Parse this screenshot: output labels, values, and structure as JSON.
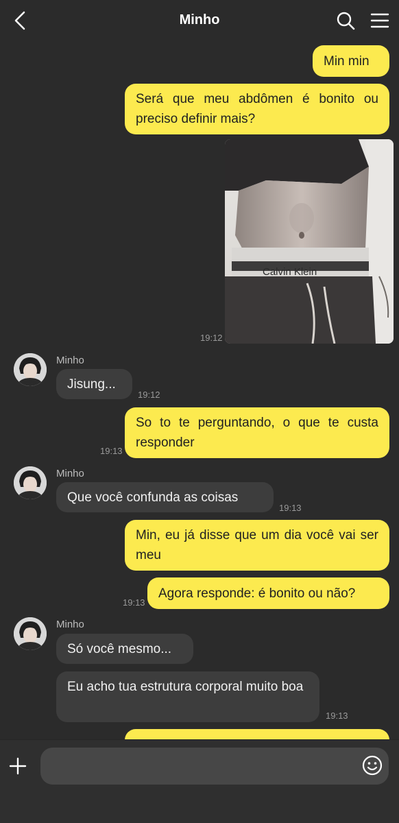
{
  "header": {
    "title": "Minho",
    "back_icon": "chevron-left-icon",
    "search_icon": "search-icon",
    "menu_icon": "hamburger-menu-icon"
  },
  "messages": [
    {
      "from": "me",
      "text": "Min min"
    },
    {
      "from": "me",
      "text": "Será que meu abdômen é bonito ou preciso definir mais?"
    },
    {
      "from": "me",
      "type": "image",
      "caption_text": "Calvin Klein",
      "time": "19:12"
    },
    {
      "from": "them",
      "sender": "Minho",
      "text": "Jisung...",
      "time": "19:12"
    },
    {
      "from": "me",
      "text": "So to te perguntando, o que te custa responder",
      "time": "19:13"
    },
    {
      "from": "them",
      "sender": "Minho",
      "text": "Que você confunda as coisas",
      "time": "19:13"
    },
    {
      "from": "me",
      "text": "Min, eu já disse que um dia você vai ser meu"
    },
    {
      "from": "me",
      "text": "Agora responde: é bonito ou não?",
      "time": "19:13"
    },
    {
      "from": "them",
      "sender": "Minho",
      "text": "Só você mesmo..."
    },
    {
      "from": "them",
      "text": "Eu acho tua estrutura corporal muito boa",
      "time": "19:13"
    }
  ],
  "input": {
    "value": "",
    "plus_icon": "plus-icon",
    "emoji_icon": "emoji-icon"
  },
  "colors": {
    "background": "#2b2b2b",
    "outgoing_bubble": "#fcea4f",
    "incoming_bubble": "#3d3d3d"
  }
}
